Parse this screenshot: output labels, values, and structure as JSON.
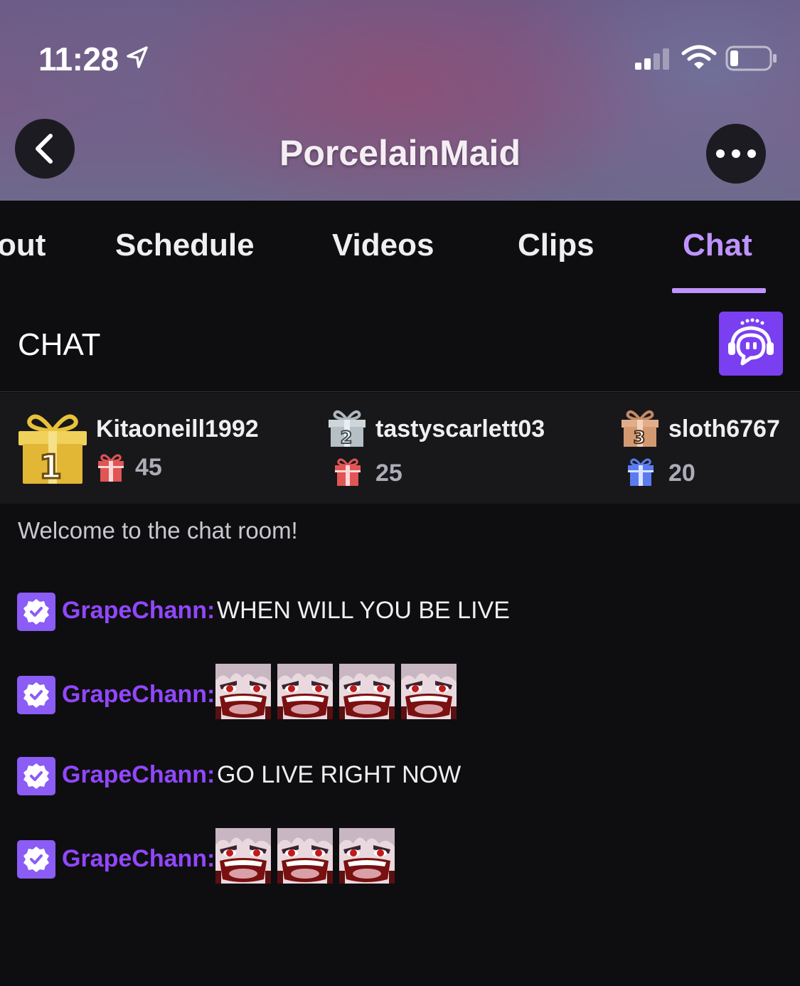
{
  "status_bar": {
    "time": "11:28",
    "icons": [
      "location-arrow-icon",
      "signal-icon",
      "wifi-icon",
      "battery-icon"
    ]
  },
  "header": {
    "channel_name": "PorcelainMaid",
    "back_icon": "chevron-left-icon",
    "more_icon": "more-dots-icon"
  },
  "tabs": {
    "items": [
      {
        "label": "out"
      },
      {
        "label": "Schedule"
      },
      {
        "label": "Videos"
      },
      {
        "label": "Clips"
      },
      {
        "label": "Chat",
        "active": true
      }
    ]
  },
  "chat": {
    "title": "CHAT",
    "bot_icon": "chatbot-icon",
    "welcome": "Welcome to the chat room!"
  },
  "leaderboard": {
    "entries": [
      {
        "rank": "1",
        "name": "Kitaoneill1992",
        "count": "45",
        "gift_color": "#e05555"
      },
      {
        "rank": "2",
        "name": "tastyscarlett03",
        "count": "25",
        "gift_color": "#e05555"
      },
      {
        "rank": "3",
        "name": "sloth6767",
        "count": "20",
        "gift_color": "#5b7cf0"
      }
    ]
  },
  "messages": [
    {
      "user": "GrapeChann:",
      "text": "WHEN WILL YOU BE LIVE",
      "emote_count": 0
    },
    {
      "user": "GrapeChann:",
      "text": "",
      "emote_count": 4
    },
    {
      "user": "GrapeChann:",
      "text": "GO LIVE RIGHT NOW",
      "emote_count": 0
    },
    {
      "user": "GrapeChann:",
      "text": "",
      "emote_count": 3
    }
  ],
  "colors": {
    "accent": "#bf94ff",
    "username": "#9147ff",
    "badge": "#8b5cf6",
    "background": "#0e0e10"
  }
}
